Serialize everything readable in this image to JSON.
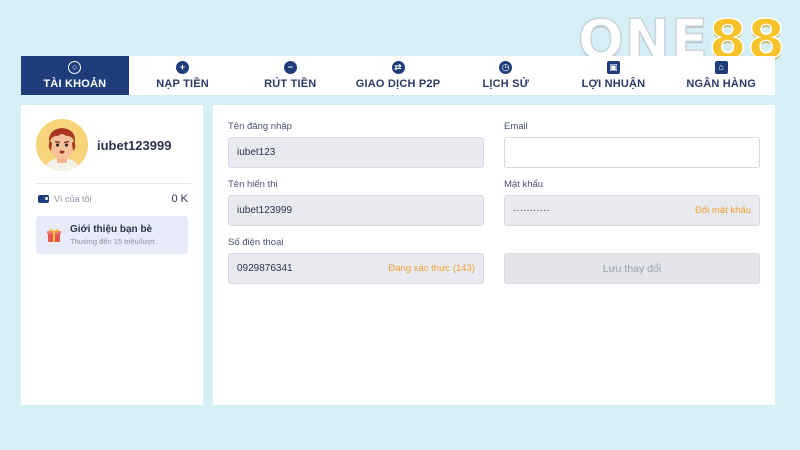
{
  "logo": {
    "part1": "ONE",
    "part2": "88"
  },
  "tabs": [
    {
      "label": "TÀI KHOẢN",
      "icon": "user-icon",
      "glyph": "○"
    },
    {
      "label": "NẠP TIỀN",
      "icon": "plus-icon",
      "glyph": "+"
    },
    {
      "label": "RÚT TIỀN",
      "icon": "minus-icon",
      "glyph": "−"
    },
    {
      "label": "GIAO DỊCH P2P",
      "icon": "swap-icon",
      "glyph": "⇄"
    },
    {
      "label": "LỊCH SỬ",
      "icon": "clock-icon",
      "glyph": "◷"
    },
    {
      "label": "LỢI NHUẬN",
      "icon": "gift-icon",
      "glyph": "▣"
    },
    {
      "label": "NGÂN HÀNG",
      "icon": "bank-icon",
      "glyph": "⌂"
    }
  ],
  "profile": {
    "username": "iubet123999",
    "wallet_label": "Ví của tôi",
    "wallet_value": "0 K",
    "referral_title": "Giới thiệu bạn bè",
    "referral_sub": "Thưởng đến 15 triệu/lượt"
  },
  "form": {
    "login_label": "Tên đăng nhập",
    "login_value": "iubet123",
    "email_label": "Email",
    "email_value": "",
    "display_label": "Tên hiển thị",
    "display_value": "iubet123999",
    "password_label": "Mật khẩu",
    "password_value": "···········",
    "password_action": "Đổi mật khẩu",
    "phone_label": "Số điện thoại",
    "phone_value": "0929876341",
    "phone_status": "Đang xác thực (143)",
    "save_label": "Lưu thay đổi"
  },
  "colors": {
    "background": "#d6eef6",
    "primary": "#1e3d7a",
    "accent": "#f0a030",
    "logo_gold": "#f6c32a"
  }
}
